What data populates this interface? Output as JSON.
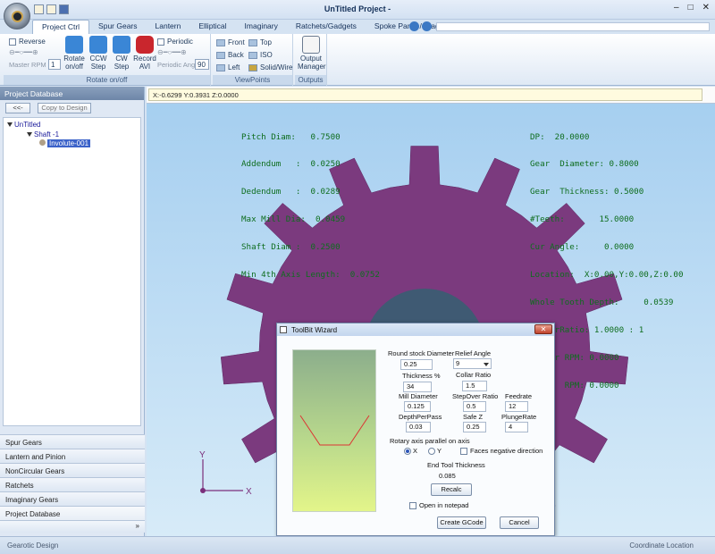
{
  "window": {
    "title": "UnTitled Project -"
  },
  "tabs": [
    {
      "label": "Project Ctrl"
    },
    {
      "label": "Spur Gears"
    },
    {
      "label": "Lantern"
    },
    {
      "label": "Elliptical"
    },
    {
      "label": "Imaginary"
    },
    {
      "label": "Ratchets/Gadgets"
    },
    {
      "label": "Spoke Panel / Diags"
    }
  ],
  "ribbon": {
    "rotate_group": {
      "label": "Rotate on/off",
      "reverse_label": "Reverse",
      "periodic_label": "Periodic",
      "master_rpm_label": "Master RPM",
      "master_rpm_value": "1",
      "periodic_ang_label": "Periodic Ang",
      "periodic_ang_value": "90",
      "rotate_btn": "Rotate on/off",
      "ccw_btn": "CCW Step",
      "cw_btn": "CW Step",
      "record_btn": "Record AVI"
    },
    "viewpoints": {
      "label": "ViewPoints",
      "front": "Front",
      "top": "Top",
      "back": "Back",
      "iso": "ISO",
      "left": "Left",
      "solid": "Solid/Wire"
    },
    "outputs": {
      "label": "Outputs",
      "output_manager": "Output Manager"
    }
  },
  "left_panel": {
    "header": "Project Database",
    "back_btn": "<<-",
    "copy_btn": "Copy to Design",
    "tree": {
      "root": "UnTitled",
      "shaft": "Shaft -1",
      "involute": "Involute-001"
    },
    "nav": [
      {
        "label": "Spur Gears"
      },
      {
        "label": "Lantern and Pinion"
      },
      {
        "label": "NonCircular Gears"
      },
      {
        "label": "Ratchets"
      },
      {
        "label": "Imaginary Gears"
      },
      {
        "label": "Project Database"
      }
    ]
  },
  "coord_readout": "X:-0.6299 Y:0.3931 Z:0.0000",
  "hud_left": [
    "Pitch Diam:   0.7500",
    "Addendum   :  0.0250",
    "Dedendum   :  0.0289",
    "Max Mill Dia:  0.0459",
    "Shaft Diam :  0.2500",
    "Min 4th Axis Length:  0.0752"
  ],
  "hud_right": [
    "DP:  20.0000",
    "Gear  Diameter: 0.8000",
    "Gear  Thickness: 0.5000",
    "#Teeth:       15.0000",
    "Cur Angle:     0.0000",
    "Location:  X:0.00,Y:0.00,Z:0.00",
    "Whole Tooth Depth:     0.0539",
    "MasterRatio: 1.0000 : 1",
    "Master RPM: 0.0000",
    "This   RPM: 0.0000"
  ],
  "axis": {
    "x": "X",
    "y": "Y"
  },
  "dialog": {
    "title": "ToolBit Wizard",
    "round_stock_label": "Round stock Diameter",
    "round_stock_value": "0.25",
    "relief_angle_label": "Relief Angle",
    "relief_angle_value": "9",
    "thickness_label": "Thickness %",
    "thickness_value": "34",
    "collar_ratio_label": "Collar Ratio",
    "collar_ratio_value": "1.5",
    "mill_diameter_label": "Mill Diameter",
    "mill_diameter_value": "0.125",
    "stepover_label": "StepOver Ratio",
    "stepover_value": "0.5",
    "feedrate_label": "Feedrate",
    "feedrate_value": "12",
    "depthperpass_label": "DepthPerPass",
    "depthperpass_value": "0.03",
    "safez_label": "Safe Z",
    "safez_value": "0.25",
    "plungerate_label": "PlungeRate",
    "plungerate_value": "4",
    "rotary_label": "Rotary axis parallel on axis",
    "radio_x": "X",
    "radio_y": "Y",
    "faces_neg_label": "Faces negative direction",
    "end_tool_label": "End Tool Thickness",
    "end_tool_value": "0.085",
    "recalc_btn": "Recalc",
    "open_notepad_label": "Open in notepad",
    "create_gcode_btn": "Create GCode",
    "cancel_btn": "Cancel"
  },
  "status": {
    "left": "Gearotic Design",
    "right": "Coordinate Location"
  },
  "colors": {
    "gear": "#7b3a7e",
    "hub": "#3f5a73",
    "hud_text": "#0e6d1e"
  }
}
